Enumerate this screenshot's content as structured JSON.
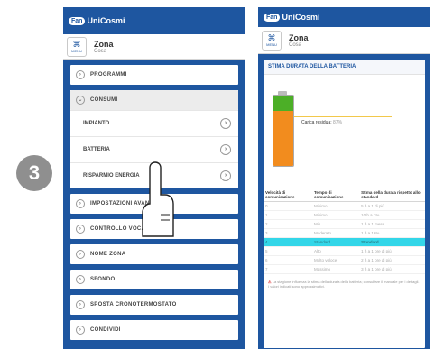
{
  "step": {
    "number": "3"
  },
  "app": {
    "logo_mark": "Fan",
    "logo_text": "UniCosmi"
  },
  "zone": {
    "icon_label": "MENU",
    "title": "Zona",
    "subtitle": "Cosa"
  },
  "left_menu": {
    "programmi": "PROGRAMMI",
    "consumi": "CONSUMI",
    "consumi_sub": [
      "IMPIANTO",
      "BATTERIA",
      "RISPARMIO ENERGIA"
    ],
    "impostazioni": "IMPOSTAZIONI AVANZATE",
    "controllo_vocale": "CONTROLLO VOCALE",
    "nome_zona": "NOME ZONA",
    "sfondo": "SFONDO",
    "sposta": "SPOSTA CRONOTERMOSTATO",
    "condividi": "CONDIVIDI"
  },
  "battery_panel": {
    "title": "STIMA DURATA DELLA BATTERIA",
    "charge_label": "Carica residua:",
    "charge_value": "87%",
    "table_headers": [
      "Velocità di comunicazione",
      "Tempo di comunicazione",
      "Stima della durata rispetto allo standard"
    ],
    "table_rows": [
      [
        "0",
        "Minimo",
        "5 h a 1 di più"
      ],
      [
        "1",
        "Minimo",
        "10 h a 1%"
      ],
      [
        "2",
        "Min",
        "1 h a 1 mese"
      ],
      [
        "3",
        "Moderato",
        "1 h a 16%"
      ],
      [
        "4",
        "Standard",
        "Standard"
      ],
      [
        "5",
        "Alto",
        "1 h a 1 ore di più"
      ],
      [
        "6",
        "Molto veloce",
        "2 h a 1 ore di più"
      ],
      [
        "7",
        "Massimo",
        "3 h a 1 ore di più"
      ]
    ],
    "highlight_row": 4,
    "footnote": "La stagione influenza la stima della durata della batteria; consultare il manuale per i dettagli. I valori indicati sono approssimativi."
  },
  "colors": {
    "brand": "#1e56a0",
    "highlight": "#33d6e8",
    "battery_charge": "#f28c1e",
    "battery_top": "#4caf27"
  },
  "icons": {
    "zone": "radiator-icon",
    "menu_circle": "circle-chevron-icon",
    "hand": "pointing-hand-icon"
  }
}
